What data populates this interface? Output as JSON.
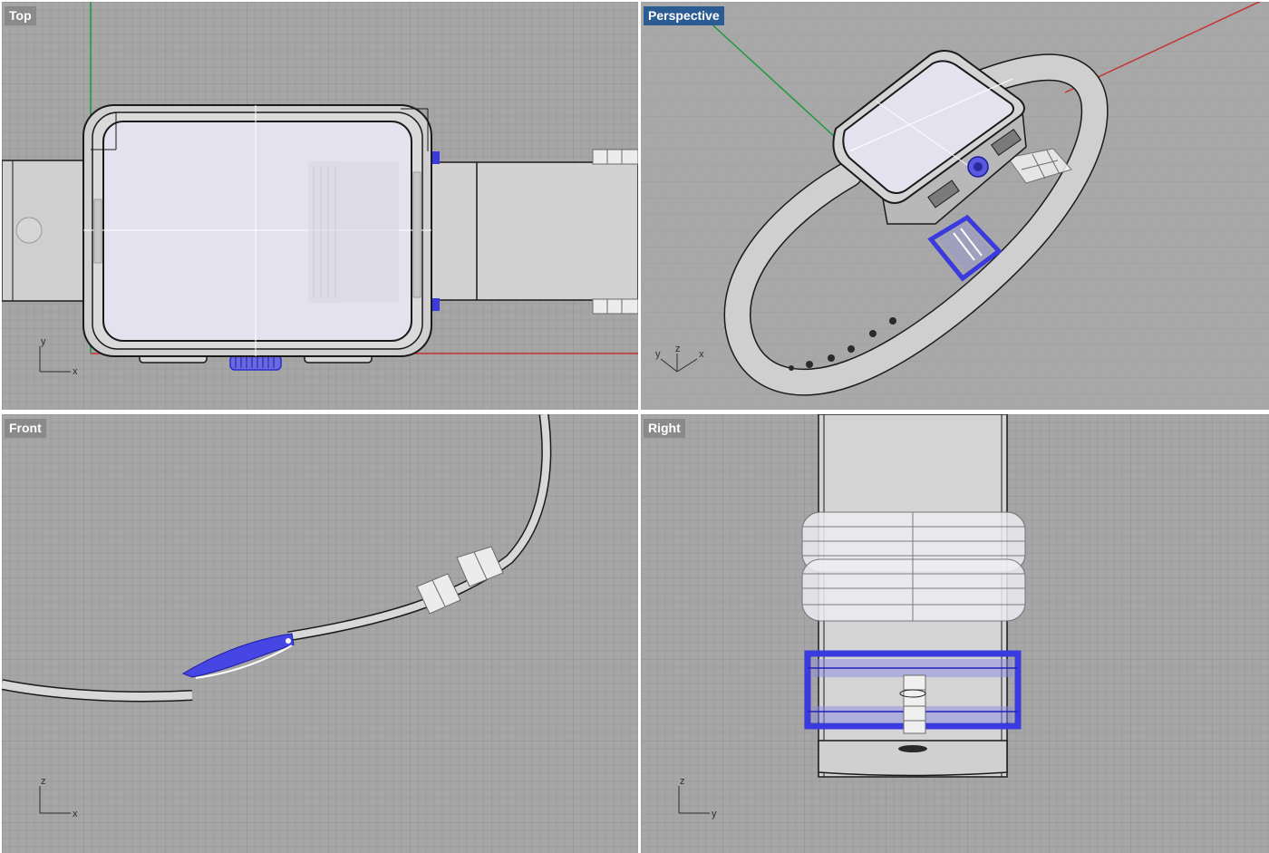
{
  "app": "Rhino 3D modeling viewports",
  "viewports": {
    "top": {
      "label": "Top",
      "active": false,
      "axes": [
        "x",
        "y"
      ]
    },
    "perspective": {
      "label": "Perspective",
      "active": true,
      "axes": [
        "x",
        "y",
        "z"
      ]
    },
    "front": {
      "label": "Front",
      "active": false,
      "axes": [
        "x",
        "z"
      ]
    },
    "right": {
      "label": "Right",
      "active": false,
      "axes": [
        "y",
        "z"
      ]
    }
  },
  "colors": {
    "viewport_bg": "#a6a6a6",
    "grid_minor": "#9c9c9c",
    "grid_major": "#8f8f8f",
    "x_axis": "#c83232",
    "y_axis": "#1f9a3c",
    "model_fill": "#dcdcdc",
    "screen_fill": "#e4e2ee",
    "selected": "#3a3adf",
    "outline": "#1a1a1a",
    "active_label": "#2a5c93",
    "inactive_label": "#8a8a8a"
  },
  "icons": [
    "axis-triad-icon"
  ]
}
